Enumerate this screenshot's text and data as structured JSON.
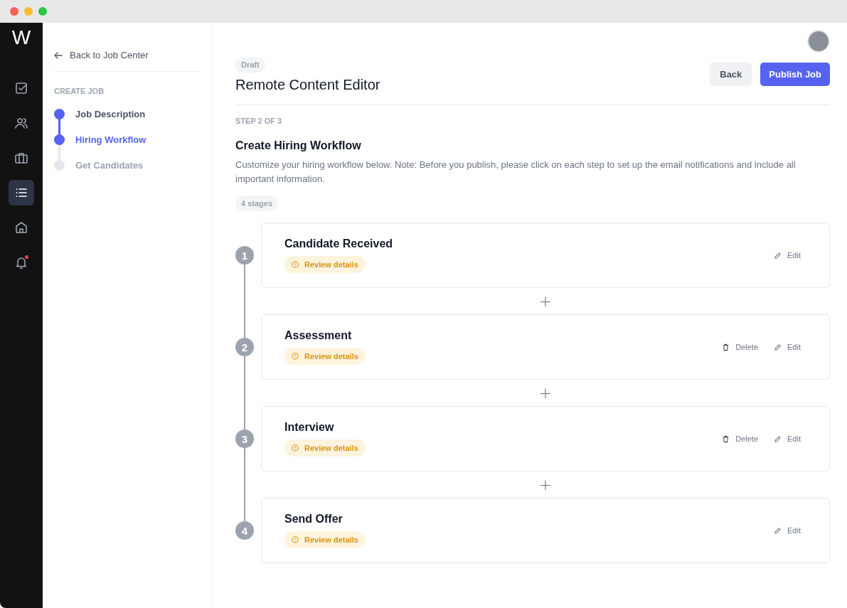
{
  "logo": "W",
  "nav": [
    {
      "selected": false,
      "dot": false
    },
    {
      "selected": false,
      "dot": false
    },
    {
      "selected": false,
      "dot": false
    },
    {
      "selected": true,
      "dot": false
    },
    {
      "selected": false,
      "dot": false
    },
    {
      "selected": false,
      "dot": true
    }
  ],
  "back_link": "Back to Job Center",
  "steps_heading": "CREATE JOB",
  "steps": [
    {
      "label": "Job Description",
      "completed": true,
      "selected": false
    },
    {
      "label": "Hiring Workflow",
      "completed": true,
      "selected": true
    },
    {
      "label": "Get Candidates",
      "completed": false,
      "selected": false
    }
  ],
  "header": {
    "status": "Draft",
    "title": "Remote Content Editor",
    "buttons": [
      {
        "label": "Back",
        "kind": "secondary"
      },
      {
        "label": "Publish Job",
        "kind": "primary"
      }
    ]
  },
  "step_label": "STEP 2 OF 3",
  "section_title": "Create Hiring Workflow",
  "section_text": "Customize your hiring workflow below. Note: Before you publish, please click on each step to set up the email notifications and include all important information.",
  "stage_count": "4 stages",
  "stages": [
    {
      "number": "1",
      "title": "Candidate Received",
      "badge": "Review details",
      "actions": [
        {
          "kind": "edit",
          "label": "Edit"
        }
      ]
    },
    {
      "number": "2",
      "title": "Assessment",
      "badge": "Review details",
      "actions": [
        {
          "kind": "delete",
          "label": "Delete"
        },
        {
          "kind": "edit",
          "label": "Edit"
        }
      ]
    },
    {
      "number": "3",
      "title": "Interview",
      "badge": "Review details",
      "actions": [
        {
          "kind": "delete",
          "label": "Delete"
        },
        {
          "kind": "edit",
          "label": "Edit"
        }
      ]
    },
    {
      "number": "4",
      "title": "Send Offer",
      "badge": "Review details",
      "actions": [
        {
          "kind": "edit",
          "label": "Edit"
        }
      ]
    }
  ],
  "add_stage_symbol": "+"
}
